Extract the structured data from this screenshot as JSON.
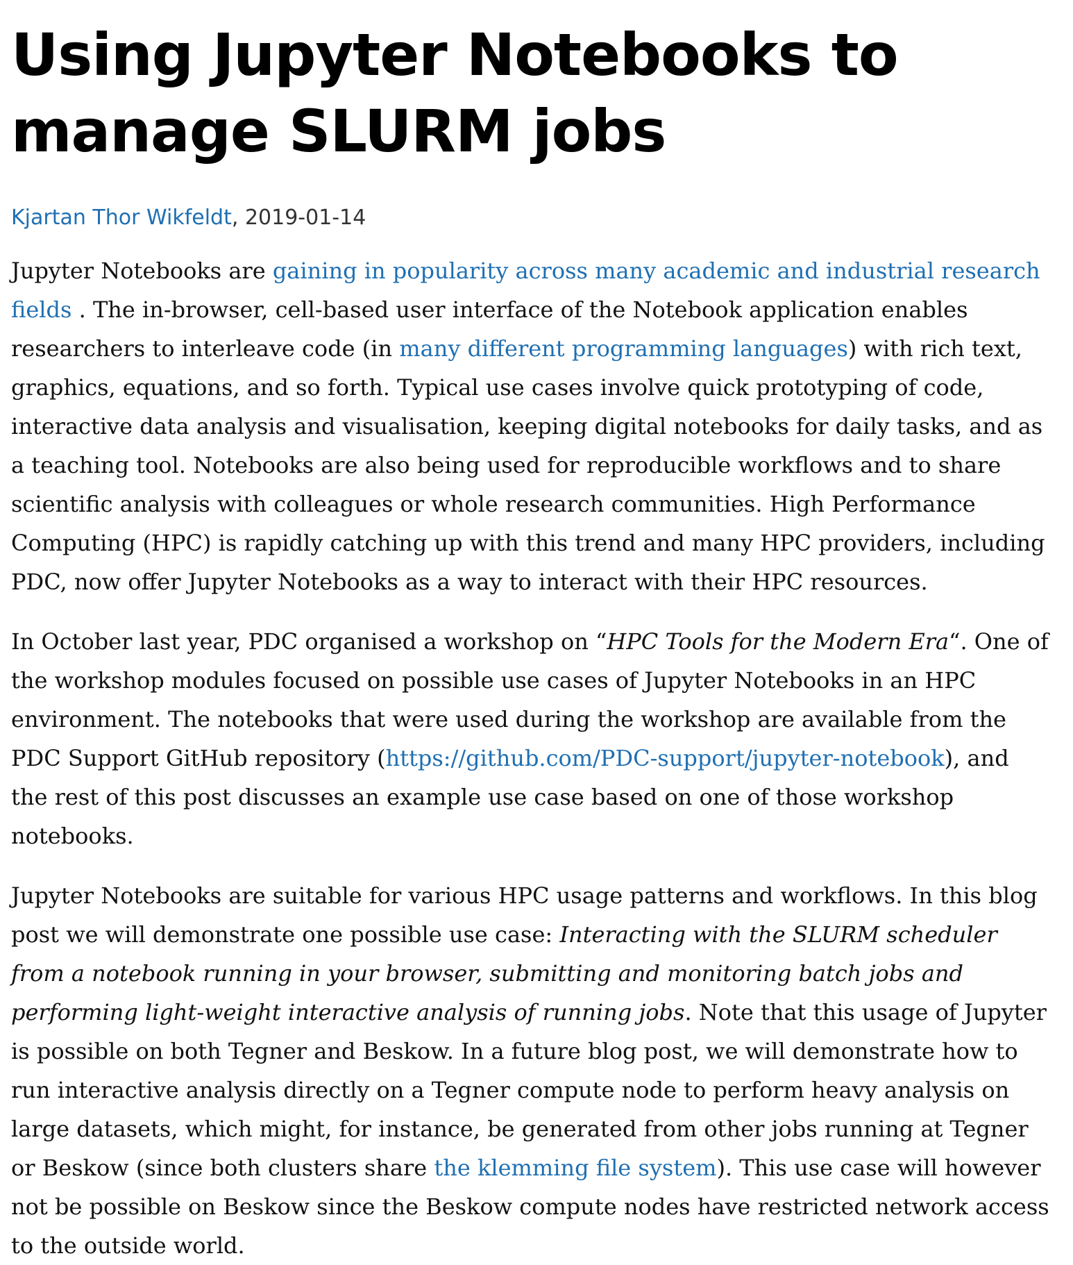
{
  "article": {
    "title": "Using Jupyter Notebooks to manage SLURM jobs",
    "author": "Kjartan Thor Wikfeldt",
    "date_sep": ", ",
    "date": "2019-01-14",
    "p1": {
      "t1": "Jupyter Notebooks are ",
      "link1": "gaining in popularity across many academic and industrial research fields",
      "t2": " . The in-browser, cell-based user interface of the Notebook application enables researchers to interleave code (in ",
      "link2": "many different programming languages",
      "t3": ") with rich text, graphics, equations, and so forth. Typical use cases involve quick prototyping of code, interactive data analysis and visualisation, keeping digital notebooks for daily tasks, and as a teaching tool. Notebooks are also being used for reproducible workflows and to share scientific analysis with colleagues or whole research communities. High Performance Computing (HPC) is rapidly catching up with this trend and many HPC providers, including PDC, now offer Jupyter Notebooks as a way to interact with their HPC resources."
    },
    "p2": {
      "t1": "In October last year, PDC organised a workshop on “",
      "em1": "HPC Tools for the Modern Era",
      "t2": "“. One of the workshop modules focused on possible use cases of Jupyter Notebooks in an HPC environment. The notebooks that were used during the workshop are available from the PDC Support GitHub repository (",
      "link1": "https://github.com/PDC-support/jupyter-notebook",
      "t3": "), and the rest of this post discusses an example use case based on one of those workshop notebooks."
    },
    "p3": {
      "t1": "Jupyter Notebooks are suitable for various HPC usage patterns and workflows. In this blog post we will demonstrate one possible use case: ",
      "em1": "Interacting with the SLURM scheduler from a notebook running in your browser, submitting and monitoring batch jobs and performing light-weight interactive analysis of running jobs",
      "t2": ". Note that this usage of Jupyter is possible on both Tegner and Beskow. In a future blog post, we will demonstrate how to run interactive analysis directly on a Tegner compute node to perform heavy analysis on large datasets, which might, for instance, be generated from other jobs running at Tegner or Beskow (since both clusters share ",
      "link1": "the klemming file system",
      "t3": "). This use case will however not be possible on Beskow since the Beskow compute nodes have restricted network access to the outside world."
    }
  },
  "colors": {
    "link": "#1f6fb2",
    "text": "#111111",
    "title": "#000000"
  }
}
